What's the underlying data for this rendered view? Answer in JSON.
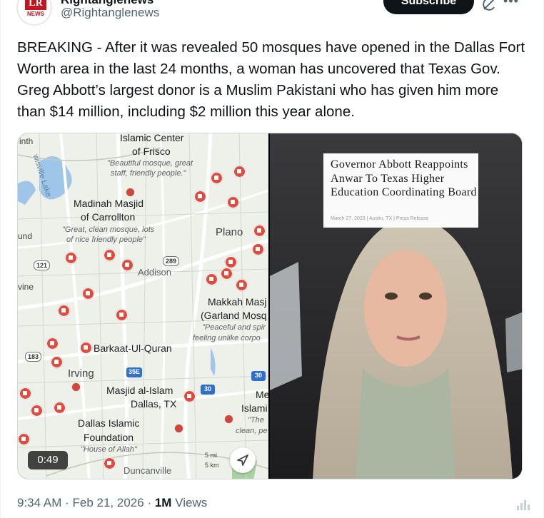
{
  "author": {
    "display_name": "Rightanglenews",
    "handle": "@Rightanglenews",
    "avatar_letters": "LR",
    "avatar_word": "NEWS"
  },
  "header": {
    "subscribe_label": "Subscribe",
    "icons": [
      "grok-icon",
      "more-icon"
    ]
  },
  "tweet": {
    "text": "BREAKING - After it was revealed 50 mosques have opened in the Dallas Fort Worth area in the last 24 months, a woman has uncovered that Texas Gov. Greg Abbott’s largest donor is a Muslim Pakistani who has given him more than $14 million, including $2 million this year alone."
  },
  "media": {
    "duration": "0:49",
    "map": {
      "labels": {
        "nth": "inth",
        "lake": "wisville Lake",
        "frisco_title": "Islamic Center",
        "frisco_sub": "of Frisco",
        "frisco_q1": "\"Beautiful mosque, great",
        "frisco_q2": "staff, friendly people.\"",
        "carrollton_title": "Madinah Masjid",
        "carrollton_sub": "of Carrollton",
        "carrollton_q1": "\"Great, clean mosque, lots",
        "carrollton_q2": "of nice friendly people\"",
        "plano": "Plano",
        "und": "und",
        "addison": "Addison",
        "vine": "vine",
        "makkah_title": "Makkah Masj",
        "makkah_sub": "(Garland Mosq",
        "makkah_q1": "\"Peaceful and spir",
        "makkah_q2": "feeling unlike corpo",
        "barkaat": "Barkaat-Ul-Quran",
        "irving": "Irving",
        "masjid_islam": "Masjid al-Islam",
        "dallas": "Dallas, TX",
        "me": "Me",
        "islami": "Islami",
        "the": "\"The",
        "clean": "clean, pe",
        "dif_title": "Dallas Islamic",
        "dif_sub": "Foundation",
        "dif_q": "\"House of Allah\"",
        "duncanville": "Duncanville",
        "scale_mi": "5 mi",
        "scale_km": "5 km"
      },
      "shields": {
        "r289": "289",
        "r121": "121",
        "r183": "183",
        "r35e": "35E",
        "r30a": "30",
        "r30b": "30"
      }
    },
    "headline": {
      "text": "Governor Abbott Reappoints Anwar To Texas Higher Education Coordinating Board",
      "meta": "March 27, 2023 | Austin, TX | Press Release"
    }
  },
  "footer": {
    "time": "9:34 AM",
    "date": "Feb 21, 2026",
    "views_count": "1M",
    "views_label": "Views"
  },
  "colors": {
    "pin": "#e24a3d",
    "water": "#9fc6e8",
    "road": "#ffffff",
    "subscribe_bg": "#0f1419"
  }
}
